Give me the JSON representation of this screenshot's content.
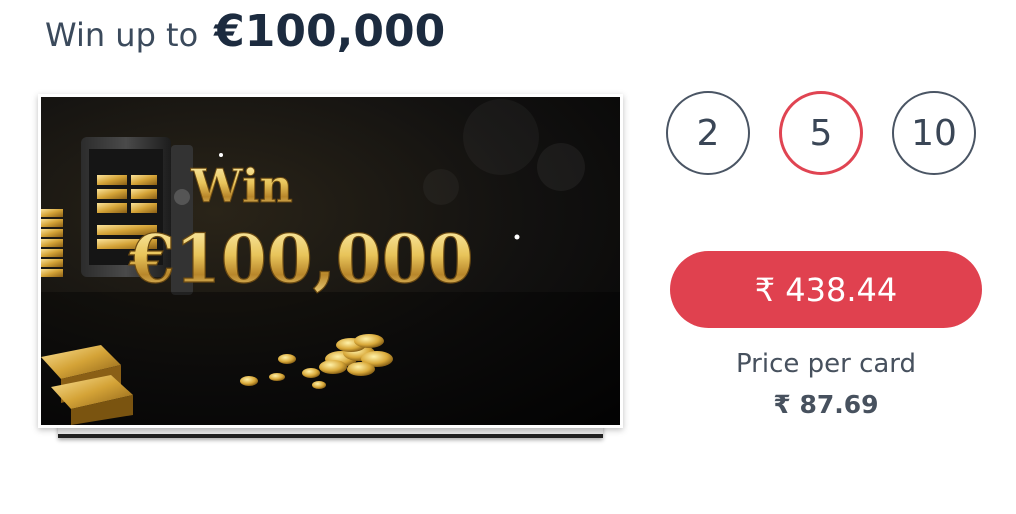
{
  "header": {
    "label": "Win up to",
    "amount": "€100,000"
  },
  "card": {
    "art_line1": "Win",
    "art_line2": "€100,000"
  },
  "quantities": [
    {
      "label": "2",
      "selected": false
    },
    {
      "label": "5",
      "selected": true
    },
    {
      "label": "10",
      "selected": false
    }
  ],
  "price": {
    "total": "₹ 438.44",
    "per_card_label": "Price per card",
    "per_card_value": "₹ 87.69"
  },
  "colors": {
    "accent": "#e0414f",
    "text_dark": "#1c2b3f",
    "text_muted": "#47515e",
    "gold": "#e8c45a"
  }
}
